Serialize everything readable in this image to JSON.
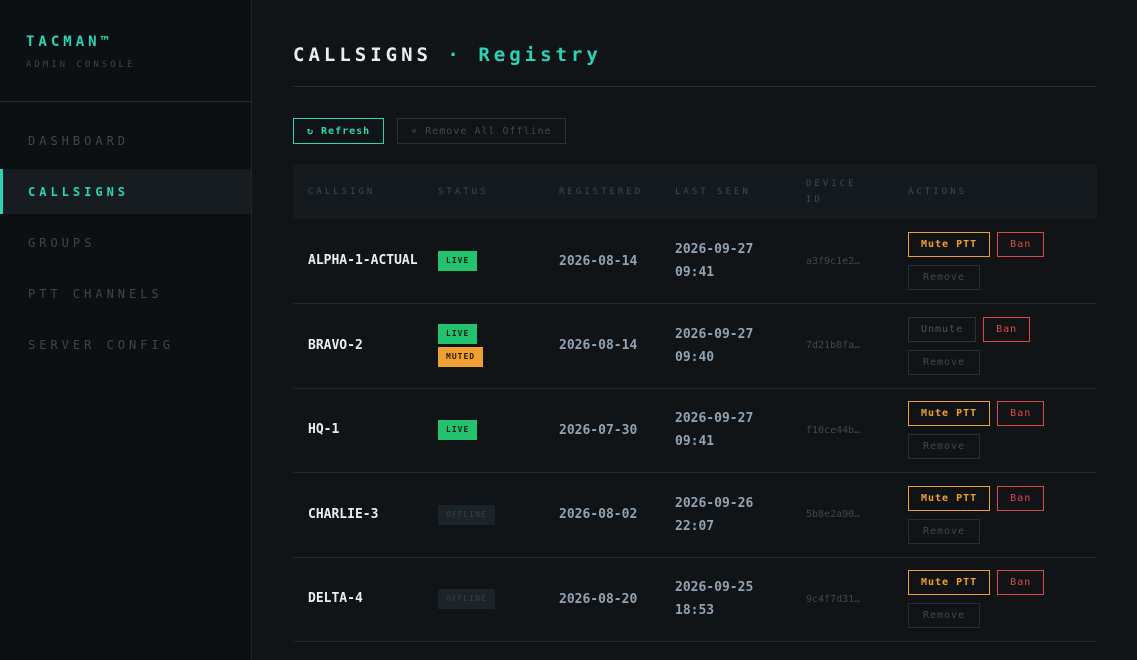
{
  "brand": {
    "title": "TACMAN™",
    "subtitle": "ADMIN CONSOLE"
  },
  "nav": {
    "items": [
      {
        "label": "DASHBOARD"
      },
      {
        "label": "CALLSIGNS"
      },
      {
        "label": "GROUPS"
      },
      {
        "label": "PTT CHANNELS"
      },
      {
        "label": "SERVER CONFIG"
      }
    ],
    "active": "CALLSIGNS"
  },
  "page": {
    "title": "CALLSIGNS",
    "separator": "·",
    "subtitle": "Registry"
  },
  "toolbar": {
    "refresh_label": "↻ Refresh",
    "remove_all_label": "× Remove All Offline"
  },
  "table": {
    "headers": {
      "callsign": "CALLSIGN",
      "status": "STATUS",
      "registered": "REGISTERED",
      "last_seen": "LAST SEEN",
      "device_id": "DEVICE ID",
      "actions": "ACTIONS"
    },
    "rows": [
      {
        "callsign": "ALPHA-1-ACTUAL",
        "status": [
          "LIVE"
        ],
        "registered": "2026-08-14",
        "last_seen": "2026-09-27 09:41",
        "device_id": "a3f9c1e2…",
        "mute_label": "Mute PTT",
        "ban_label": "Ban",
        "remove_label": "Remove"
      },
      {
        "callsign": "BRAVO-2",
        "status": [
          "LIVE",
          "MUTED"
        ],
        "registered": "2026-08-14",
        "last_seen": "2026-09-27 09:40",
        "device_id": "7d21b8fa…",
        "mute_label": "Unmute",
        "ban_label": "Ban",
        "remove_label": "Remove"
      },
      {
        "callsign": "HQ-1",
        "status": [
          "LIVE"
        ],
        "registered": "2026-07-30",
        "last_seen": "2026-09-27 09:41",
        "device_id": "f10ce44b…",
        "mute_label": "Mute PTT",
        "ban_label": "Ban",
        "remove_label": "Remove"
      },
      {
        "callsign": "CHARLIE-3",
        "status": [
          "OFFLINE"
        ],
        "registered": "2026-08-02",
        "last_seen": "2026-09-26 22:07",
        "device_id": "5b8e2a90…",
        "mute_label": "Mute PTT",
        "ban_label": "Ban",
        "remove_label": "Remove"
      },
      {
        "callsign": "DELTA-4",
        "status": [
          "OFFLINE"
        ],
        "registered": "2026-08-20",
        "last_seen": "2026-09-25 18:53",
        "device_id": "9c4f7d31…",
        "mute_label": "Mute PTT",
        "ban_label": "Ban",
        "remove_label": "Remove"
      }
    ]
  },
  "colors": {
    "accent": "#2ad4b5",
    "live": "#22c26e",
    "muted": "#f0a030",
    "danger": "#e04848",
    "background": "#111417"
  }
}
